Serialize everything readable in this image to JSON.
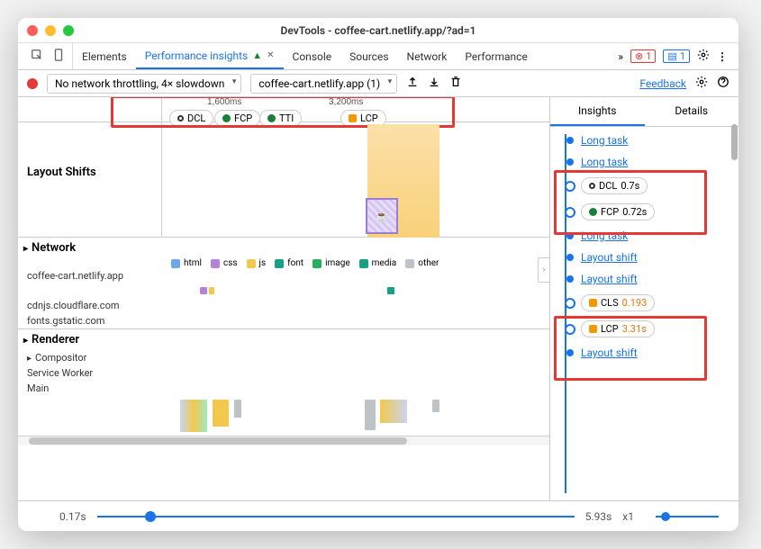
{
  "window_title": "DevTools - coffee-cart.netlify.app/?ad=1",
  "tabs": {
    "elements": "Elements",
    "performance_insights": "Performance insights",
    "console": "Console",
    "sources": "Sources",
    "network": "Network",
    "performance": "Performance"
  },
  "badges": {
    "errors": "1",
    "messages": "1"
  },
  "toolbar": {
    "throttling": "No network throttling, 4× slowdown",
    "page_select": "coffee-cart.netlify.app (1)",
    "feedback": "Feedback"
  },
  "ruler": {
    "t1": "1,600ms",
    "t2": "3,200ms"
  },
  "markers": {
    "dcl": "DCL",
    "fcp": "FCP",
    "tti": "TTI",
    "lcp": "LCP"
  },
  "layout_shifts_label": "Layout Shifts",
  "sections": {
    "network": "Network",
    "net_hosts": [
      "coffee-cart.netlify.app",
      "cdnjs.cloudflare.com",
      "fonts.gstatic.com"
    ],
    "renderer": "Renderer",
    "compositor": "Compositor",
    "service_worker": "Service Worker",
    "main": "Main"
  },
  "legend": {
    "html": "html",
    "css": "css",
    "js": "js",
    "font": "font",
    "image": "image",
    "media": "media",
    "other": "other"
  },
  "legend_colors": {
    "html": "#6ea6e8",
    "css": "#b383d8",
    "js": "#f2c94c",
    "font": "#16a085",
    "image": "#27ae60",
    "media": "#16a085",
    "other": "#bdc3c7"
  },
  "insights": {
    "tab_insights": "Insights",
    "tab_details": "Details",
    "items": [
      {
        "type": "link",
        "text": "Long task"
      },
      {
        "type": "link",
        "text": "Long task"
      },
      {
        "type": "metric",
        "icon": "dcl",
        "label": "DCL",
        "value": "0.7s"
      },
      {
        "type": "metric",
        "icon": "fcp",
        "label": "FCP",
        "value": "0.72s"
      },
      {
        "type": "link",
        "text": "Long task"
      },
      {
        "type": "link",
        "text": "Layout shift"
      },
      {
        "type": "link",
        "text": "Layout shift"
      },
      {
        "type": "metric",
        "icon": "cls",
        "label": "CLS",
        "value": "0.193",
        "warn": true
      },
      {
        "type": "metric",
        "icon": "lcp",
        "label": "LCP",
        "value": "3.31s",
        "warn": true
      },
      {
        "type": "link",
        "text": "Layout shift"
      }
    ]
  },
  "footer": {
    "start": "0.17s",
    "end": "5.93s",
    "zoom": "x1"
  }
}
